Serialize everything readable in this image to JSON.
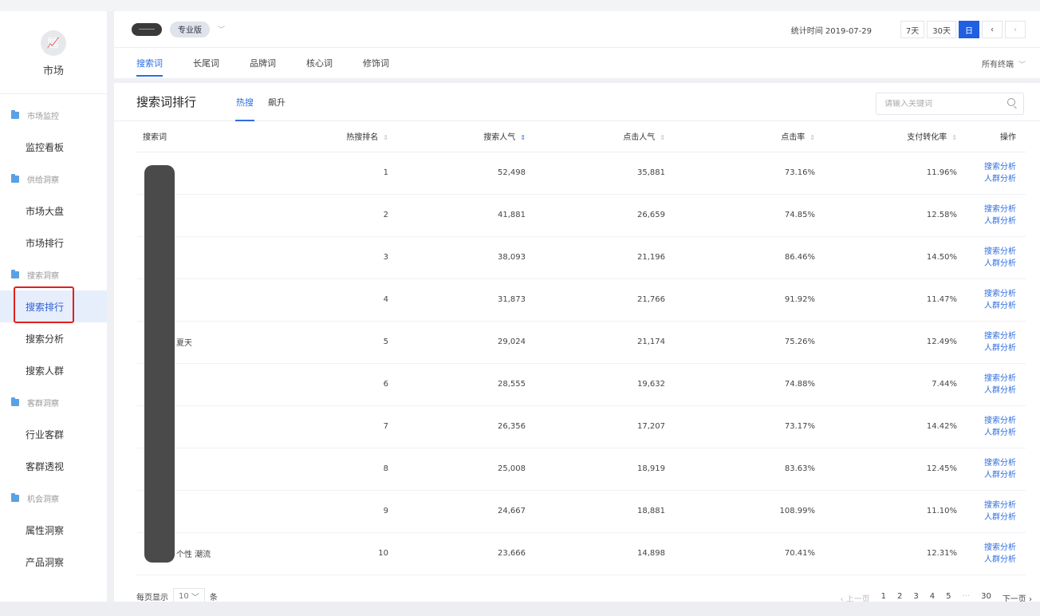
{
  "sidebar": {
    "logo_icon": "market-chart-icon",
    "logo_label": "市场",
    "groups": [
      {
        "label": "市场监控",
        "items": [
          {
            "label": "监控看板"
          }
        ]
      },
      {
        "label": "供给洞察",
        "items": [
          {
            "label": "市场大盘"
          },
          {
            "label": "市场排行"
          }
        ]
      },
      {
        "label": "搜索洞察",
        "items": [
          {
            "label": "搜索排行",
            "active": true
          },
          {
            "label": "搜索分析"
          },
          {
            "label": "搜索人群"
          }
        ]
      },
      {
        "label": "客群洞察",
        "items": [
          {
            "label": "行业客群"
          },
          {
            "label": "客群透视"
          }
        ]
      },
      {
        "label": "机会洞察",
        "items": [
          {
            "label": "属性洞察"
          },
          {
            "label": "产品洞察"
          }
        ]
      }
    ]
  },
  "header": {
    "edition": "专业版",
    "stat_time": "统计时间 2019-07-29",
    "periods": [
      {
        "label": "7天",
        "active": false
      },
      {
        "label": "30天",
        "active": false
      },
      {
        "label": "日",
        "active": true
      }
    ],
    "prev": "‹",
    "next": "›",
    "tabs": [
      {
        "label": "搜索词",
        "active": true
      },
      {
        "label": "长尾词",
        "active": false
      },
      {
        "label": "品牌词",
        "active": false
      },
      {
        "label": "核心词",
        "active": false
      },
      {
        "label": "修饰词",
        "active": false
      }
    ],
    "category": "所有终端"
  },
  "panel": {
    "title": "搜索词排行",
    "subtabs": [
      {
        "label": "热搜",
        "active": true
      },
      {
        "label": "飙升",
        "active": false
      }
    ],
    "search_placeholder": "请输入关键词"
  },
  "table": {
    "columns": [
      "搜索词",
      "热搜排名",
      "搜索人气",
      "点击人气",
      "点击率",
      "支付转化率",
      "操作"
    ],
    "sort_active": "搜索人气",
    "rows": [
      {
        "word": "",
        "rank": "1",
        "search": "52,498",
        "click": "35,881",
        "ctr": "73.16%",
        "conv": "11.96%"
      },
      {
        "word": "",
        "rank": "2",
        "search": "41,881",
        "click": "26,659",
        "ctr": "74.85%",
        "conv": "12.58%"
      },
      {
        "word": "",
        "rank": "3",
        "search": "38,093",
        "click": "21,196",
        "ctr": "86.46%",
        "conv": "14.50%"
      },
      {
        "word": "",
        "rank": "4",
        "search": "31,873",
        "click": "21,766",
        "ctr": "91.92%",
        "conv": "11.47%"
      },
      {
        "word": "夏天",
        "rank": "5",
        "search": "29,024",
        "click": "21,174",
        "ctr": "75.26%",
        "conv": "12.49%"
      },
      {
        "word": "",
        "rank": "6",
        "search": "28,555",
        "click": "19,632",
        "ctr": "74.88%",
        "conv": "7.44%"
      },
      {
        "word": "",
        "rank": "7",
        "search": "26,356",
        "click": "17,207",
        "ctr": "73.17%",
        "conv": "14.42%"
      },
      {
        "word": "",
        "rank": "8",
        "search": "25,008",
        "click": "18,919",
        "ctr": "83.63%",
        "conv": "12.45%"
      },
      {
        "word": "",
        "rank": "9",
        "search": "24,667",
        "click": "18,881",
        "ctr": "108.99%",
        "conv": "11.10%"
      },
      {
        "word": "个性 潮流",
        "rank": "10",
        "search": "23,666",
        "click": "14,898",
        "ctr": "70.41%",
        "conv": "12.31%"
      }
    ],
    "actions": [
      "搜索分析",
      "人群分析"
    ]
  },
  "footer": {
    "page_size_label": "每页显示",
    "page_size": "10",
    "page_size_unit": "条",
    "prev_label": "‹ 上一页",
    "pages": [
      "1",
      "2",
      "3",
      "4",
      "5",
      "···",
      "30"
    ],
    "next_label": "下一页 ›"
  }
}
